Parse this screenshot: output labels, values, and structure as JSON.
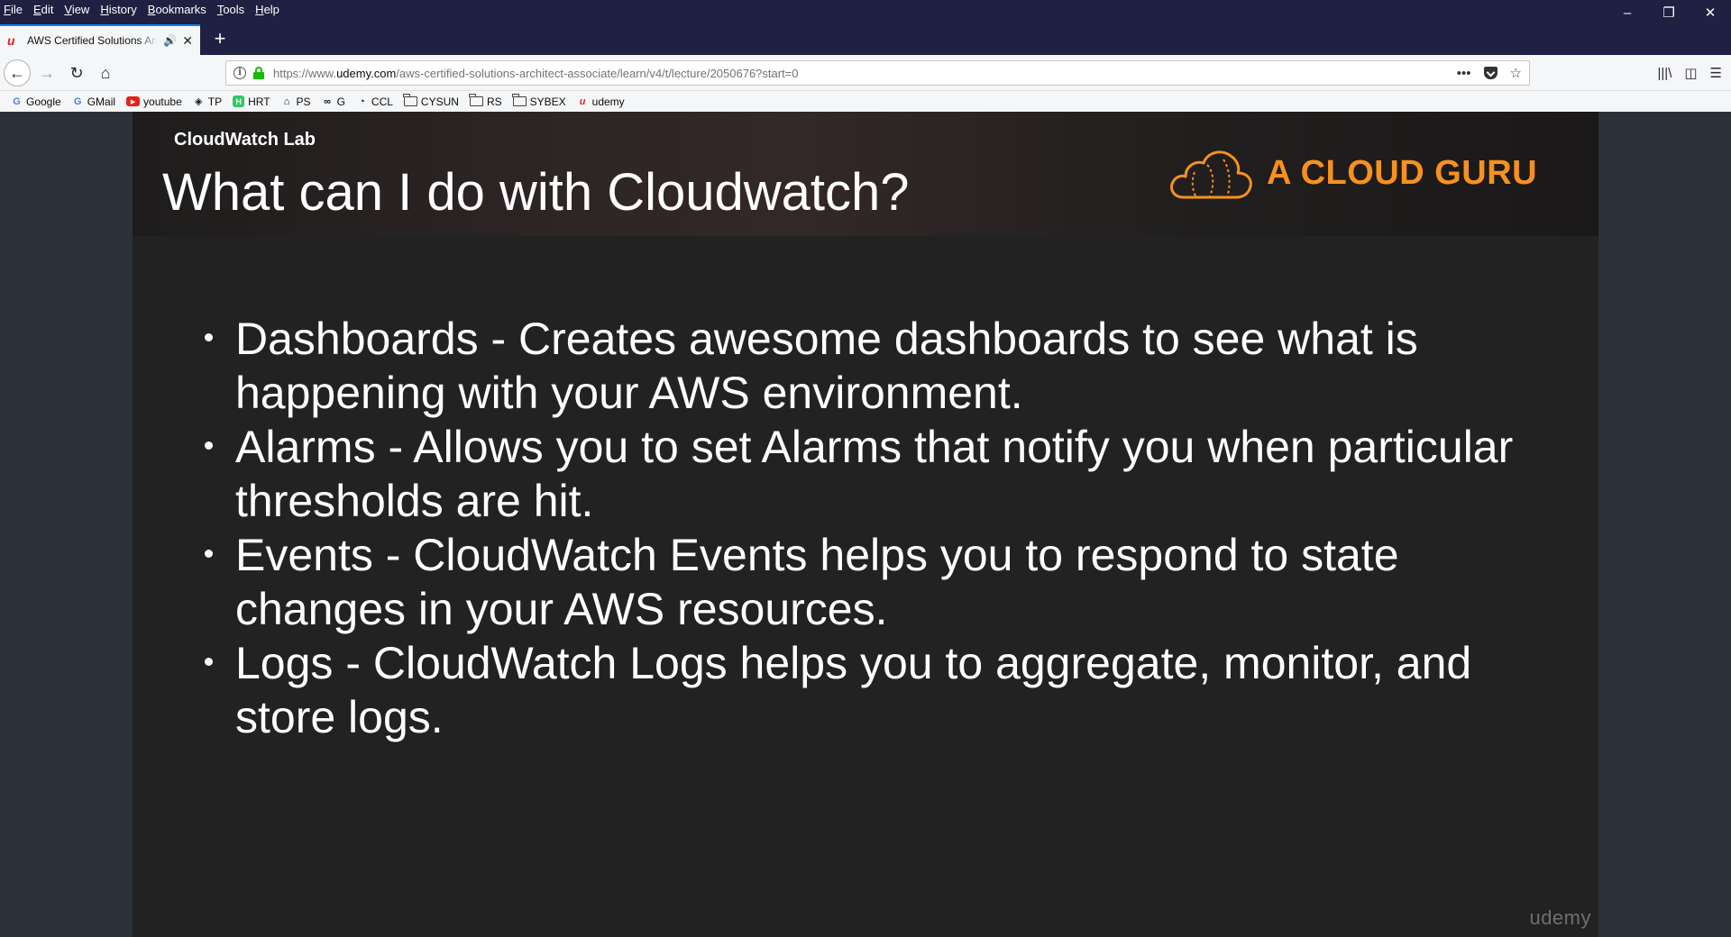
{
  "browser": {
    "menu": [
      "File",
      "Edit",
      "View",
      "History",
      "Bookmarks",
      "Tools",
      "Help"
    ],
    "window_controls": {
      "minimize": "–",
      "restore": "❐",
      "close": "✕"
    },
    "tab": {
      "title": "AWS Certified Solutions Architect",
      "favicon": "u",
      "audio_icon": "🔊",
      "close_icon": "✕"
    },
    "new_tab_icon": "+",
    "nav": {
      "back_icon": "←",
      "forward_icon": "→",
      "reload_icon": "↻",
      "home_icon": "⌂"
    },
    "url": {
      "prefix": "https://www.",
      "host": "udemy.com",
      "path": "/aws-certified-solutions-architect-associate/learn/v4/t/lecture/2050676?start=0",
      "info_icon": "i",
      "more_icon": "•••",
      "star_icon": "☆"
    },
    "tools": {
      "library_icon": "|||\\",
      "sidebar_icon": "◫",
      "menu_icon": "☰"
    },
    "bookmarks": [
      {
        "label": "Google",
        "icon": "G"
      },
      {
        "label": "GMail",
        "icon": "G"
      },
      {
        "label": "youtube",
        "icon": "▶"
      },
      {
        "label": "TP",
        "icon": "◈"
      },
      {
        "label": "HRT",
        "icon": "H"
      },
      {
        "label": "PS",
        "icon": "⌂"
      },
      {
        "label": "G",
        "icon": "∞"
      },
      {
        "label": "CCL",
        "icon": "◔"
      },
      {
        "label": "CYSUN",
        "icon": ""
      },
      {
        "label": "RS",
        "icon": ""
      },
      {
        "label": "SYBEX",
        "icon": ""
      },
      {
        "label": "udemy",
        "icon": "u"
      }
    ]
  },
  "slide": {
    "lab_label": "CloudWatch Lab",
    "title": "What can I do with Cloudwatch?",
    "brand": "A CLOUD GURU",
    "bullets": [
      "Dashboards - Creates awesome dashboards to see what is happening with your AWS environment.",
      "Alarms - Allows you to set Alarms that notify you when particular thresholds are hit.",
      "Events - CloudWatch Events helps you to respond to state changes in your AWS resources.",
      "Logs - CloudWatch Logs helps you to aggregate, monitor, and store logs."
    ],
    "watermark": "udemy"
  },
  "colors": {
    "titlebar": "#1f2042",
    "page_background": "#2b303b",
    "slide_background": "#222222",
    "brand_orange": "#f7911e",
    "lock_green": "#12bc00"
  }
}
